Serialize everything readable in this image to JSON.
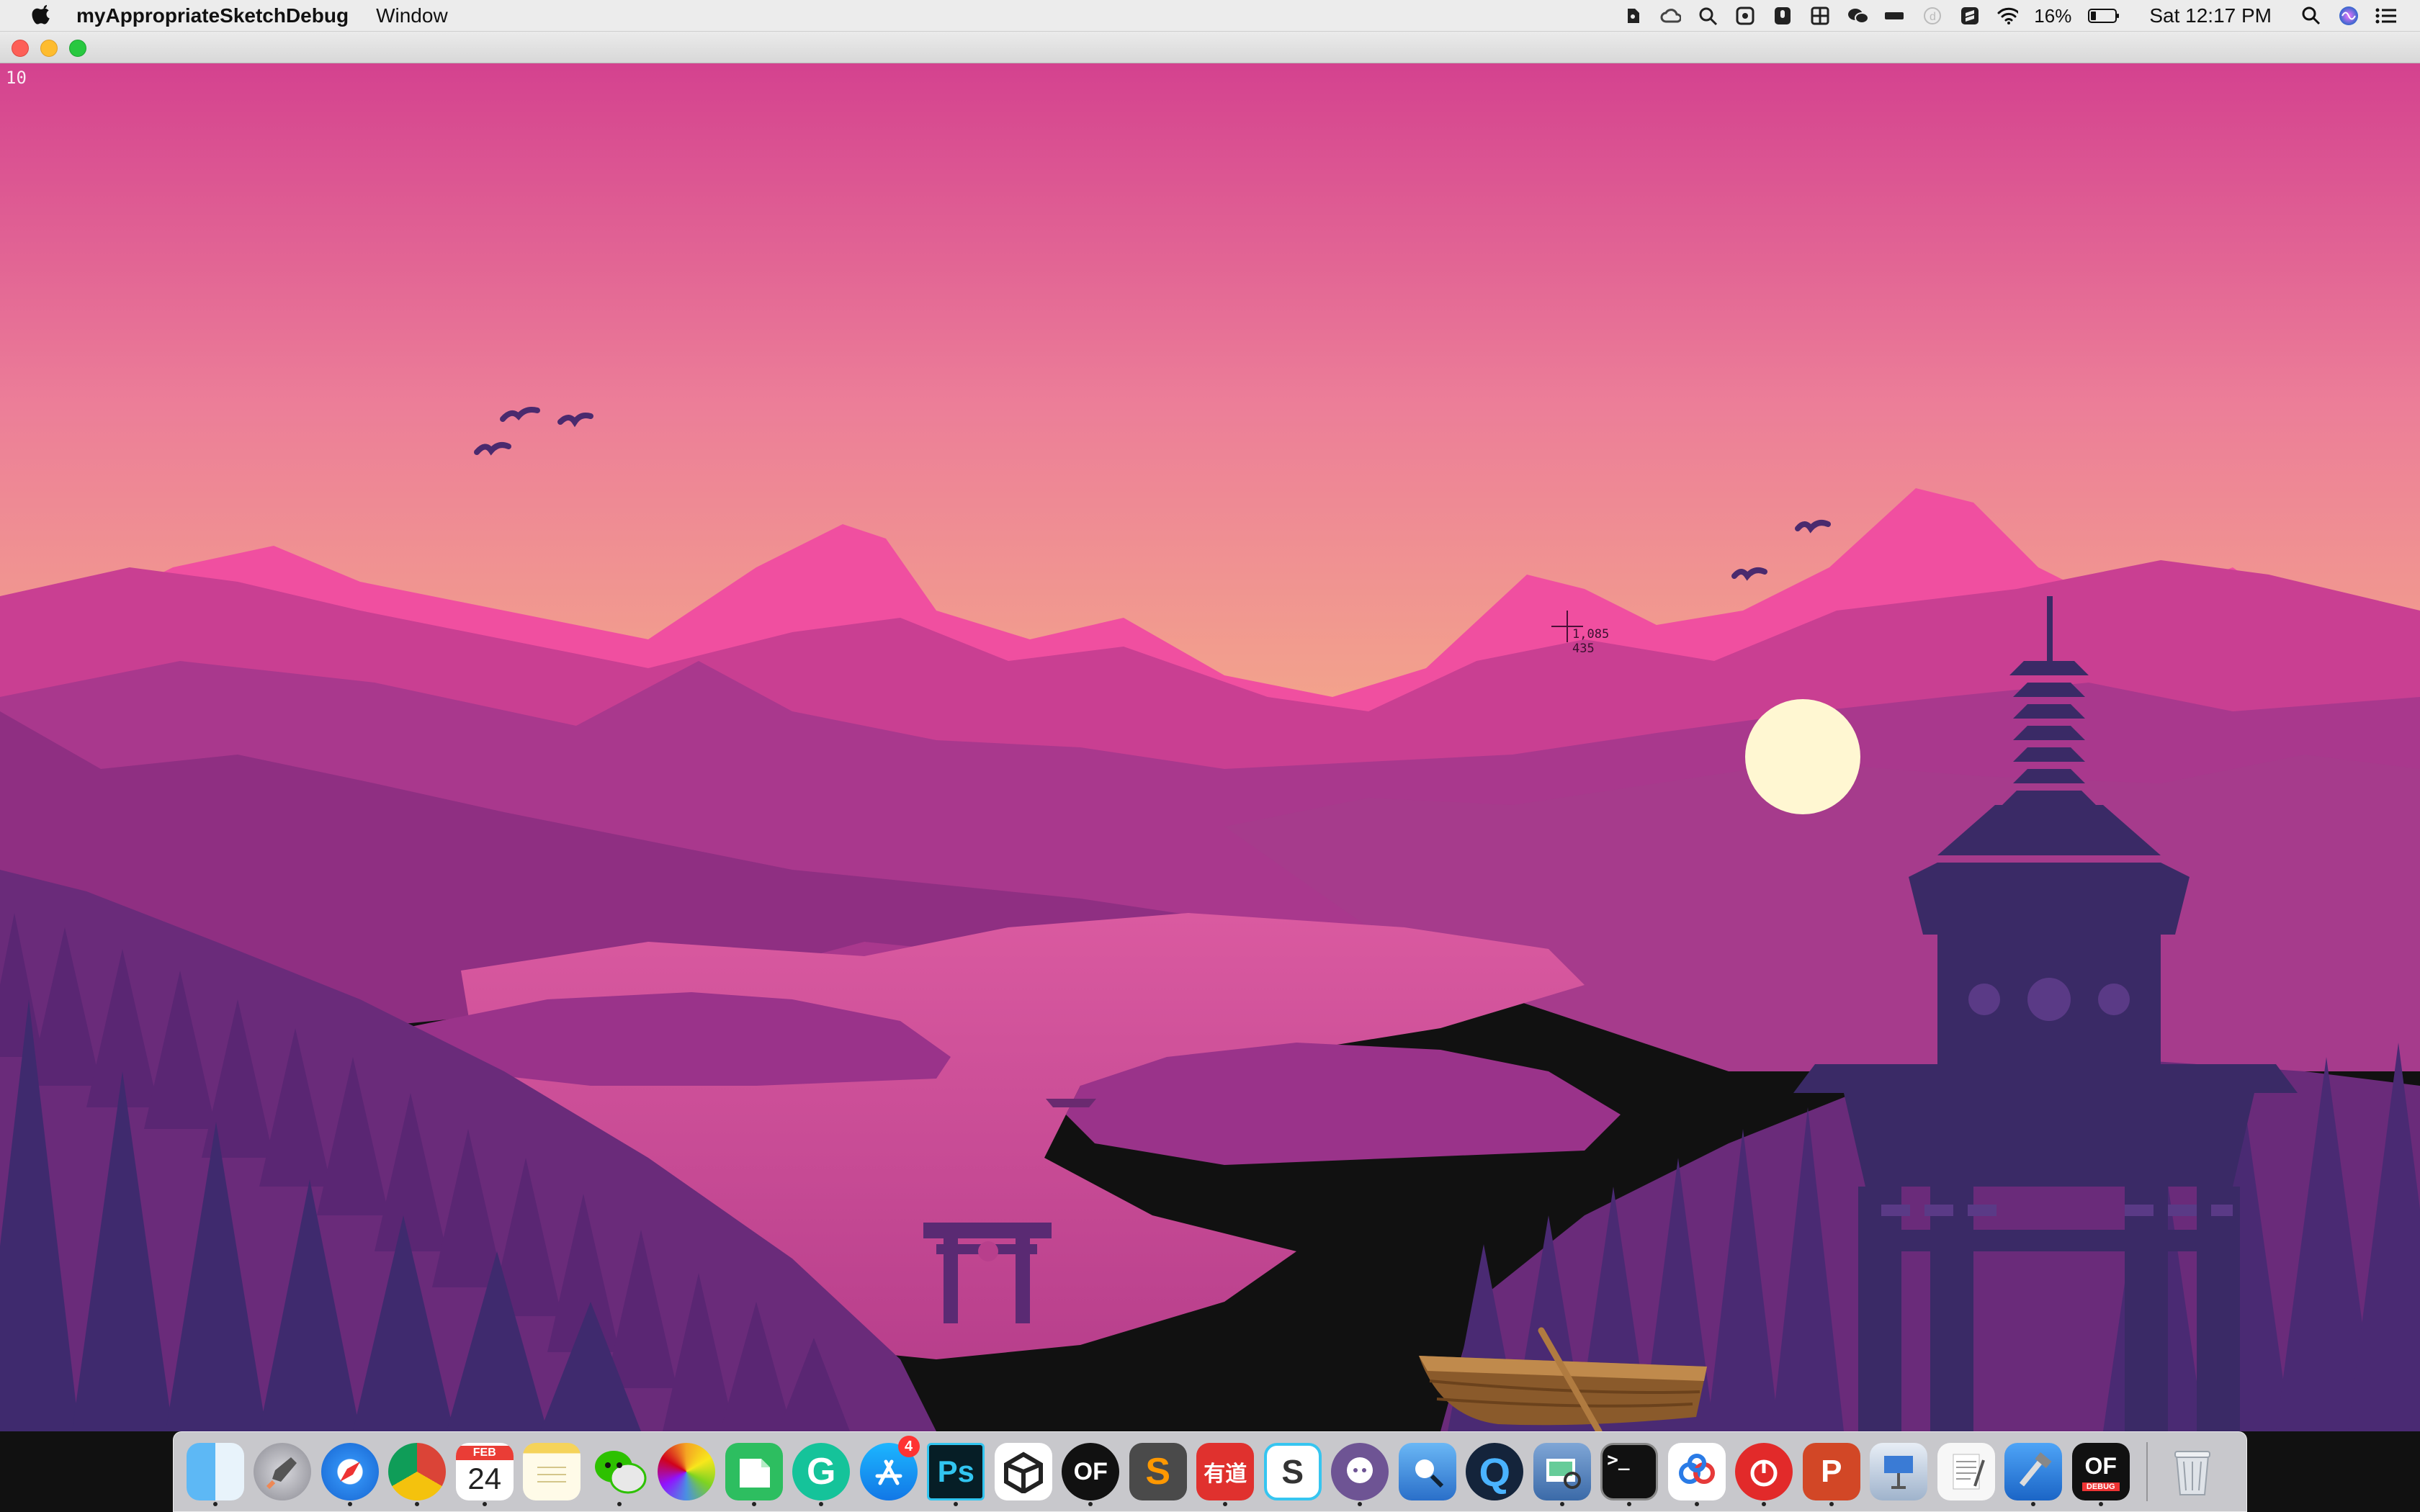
{
  "menubar": {
    "app_name": "myAppropriateSketchDebug",
    "menus": [
      "Window"
    ],
    "battery": "16%",
    "clock": "Sat 12:17 PM"
  },
  "sketch": {
    "frame_counter": "10",
    "cursor_x": "1,085",
    "cursor_y": "435",
    "colors": {
      "sky_top": "#d4428f",
      "sky_horizon": "#f0a08c",
      "far_mountain": "#f04fa0",
      "mid_mountain": "#c43c8f",
      "near_mountain": "#8e2f80",
      "lake": "#d0509a",
      "forest": "#5a2a76",
      "pagoda": "#3a2a66",
      "moon": "#fff7d2"
    }
  },
  "dock": {
    "apps": [
      {
        "name": "Finder",
        "icon": "finder-icon",
        "label": "",
        "running": true
      },
      {
        "name": "Launchpad",
        "icon": "rocket-icon",
        "label": "",
        "running": false
      },
      {
        "name": "Safari",
        "icon": "compass-icon",
        "label": "",
        "running": true
      },
      {
        "name": "Chrome",
        "icon": "chrome-icon",
        "label": "",
        "running": true
      },
      {
        "name": "Calendar",
        "icon": "calendar-icon",
        "label": "24",
        "month": "FEB",
        "running": true
      },
      {
        "name": "Notes",
        "icon": "notepad-icon",
        "label": "",
        "running": false
      },
      {
        "name": "WeChat",
        "icon": "chat-bubbles-icon",
        "label": "",
        "running": true
      },
      {
        "name": "Photos",
        "icon": "photos-flower-icon",
        "label": "",
        "running": false
      },
      {
        "name": "Evernote",
        "icon": "elephant-icon",
        "label": "",
        "running": true
      },
      {
        "name": "Grammarly",
        "icon": "grammarly-icon",
        "label": "G",
        "running": true
      },
      {
        "name": "App Store",
        "icon": "app-store-icon",
        "label": "",
        "badge": "4",
        "running": false
      },
      {
        "name": "Photoshop",
        "icon": "photoshop-icon",
        "label": "Ps",
        "running": true
      },
      {
        "name": "Unity",
        "icon": "unity-cube-icon",
        "label": "",
        "running": false
      },
      {
        "name": "openFrameworks",
        "icon": "of-icon",
        "label": "OF",
        "running": true
      },
      {
        "name": "Sublime Text",
        "icon": "sublime-icon",
        "label": "S",
        "running": false
      },
      {
        "name": "Youdao",
        "icon": "youdao-icon",
        "label": "有道",
        "running": true
      },
      {
        "name": "Slack",
        "icon": "slack-icon",
        "label": "S",
        "running": false
      },
      {
        "name": "GitHub Desktop",
        "icon": "octocat-icon",
        "label": "",
        "running": true
      },
      {
        "name": "Directory Utility",
        "icon": "magnifier-doc-icon",
        "label": "",
        "running": false
      },
      {
        "name": "QuickTime",
        "icon": "quicktime-icon",
        "label": "Q",
        "running": false
      },
      {
        "name": "Preview",
        "icon": "preview-photos-icon",
        "label": "",
        "running": true
      },
      {
        "name": "Terminal",
        "icon": "terminal-icon",
        "label": ">_",
        "running": true
      },
      {
        "name": "Baidu Netdisk",
        "icon": "cloud-icon",
        "label": "",
        "running": true
      },
      {
        "name": "NetEase Music",
        "icon": "music-icon",
        "label": "",
        "running": true
      },
      {
        "name": "PowerPoint",
        "icon": "powerpoint-icon",
        "label": "P",
        "running": true
      },
      {
        "name": "Keynote",
        "icon": "keynote-podium-icon",
        "label": "",
        "running": false
      },
      {
        "name": "TextEdit",
        "icon": "textedit-icon",
        "label": "",
        "running": false
      },
      {
        "name": "Xcode",
        "icon": "xcode-hammer-icon",
        "label": "",
        "running": true
      },
      {
        "name": "myAppropriateSketchDebug",
        "icon": "of-debug-icon",
        "label": "OF",
        "sublabel": "DEBUG",
        "running": true
      }
    ],
    "trash": {
      "name": "Trash",
      "icon": "trash-icon"
    }
  }
}
